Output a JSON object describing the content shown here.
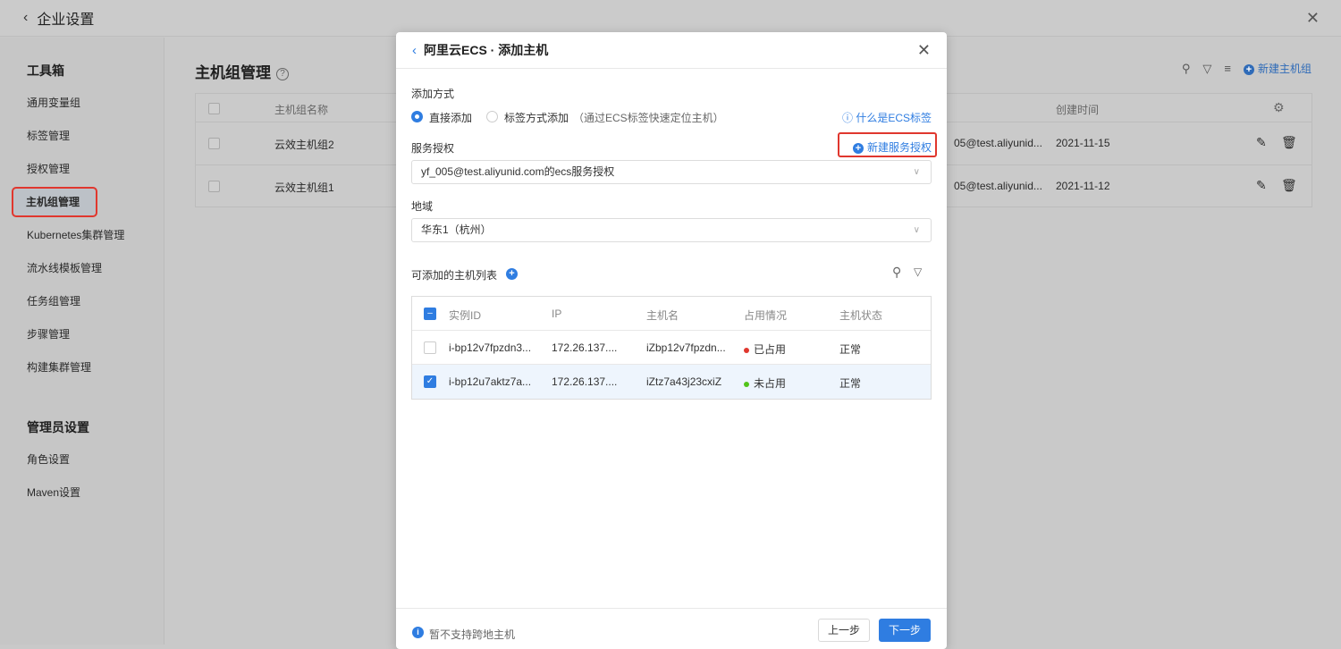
{
  "topbar": {
    "title": "企业设置"
  },
  "sidebar": {
    "section1": "工具箱",
    "items1": [
      "通用变量组",
      "标签管理",
      "授权管理",
      "主机组管理",
      "Kubernetes集群管理",
      "流水线模板管理",
      "任务组管理",
      "步骤管理",
      "构建集群管理"
    ],
    "section2": "管理员设置",
    "items2": [
      "角色设置",
      "Maven设置"
    ]
  },
  "main": {
    "title": "主机组管理",
    "new_button": "新建主机组",
    "columns": [
      "主机组名称",
      "创建时间"
    ],
    "rows": [
      {
        "name": "云效主机组2",
        "creator": "05@test.aliyunid...",
        "date": "2021-11-15"
      },
      {
        "name": "云效主机组1",
        "creator": "05@test.aliyunid...",
        "date": "2021-11-12"
      }
    ]
  },
  "modal": {
    "title": "阿里云ECS · 添加主机",
    "add_method_label": "添加方式",
    "radio_direct": "直接添加",
    "radio_tag": "标签方式添加",
    "radio_tag_hint": "（通过ECS标签快速定位主机）",
    "what_is_tag": "什么是ECS标签",
    "auth_label": "服务授权",
    "new_auth": "新建服务授权",
    "auth_value": "yf_005@test.aliyunid.com的ecs服务授权",
    "region_label": "地域",
    "region_value": "华东1（杭州）",
    "list_label": "可添加的主机列表",
    "columns": [
      "实例ID",
      "IP",
      "主机名",
      "占用情况",
      "主机状态"
    ],
    "hosts": [
      {
        "id": "i-bp12v7fpzdn3...",
        "ip": "172.26.137....",
        "name": "iZbp12v7fpzdn...",
        "usage": "已占用",
        "usage_color": "#e0372e",
        "status": "正常",
        "checked": false
      },
      {
        "id": "i-bp12u7aktz7a...",
        "ip": "172.26.137....",
        "name": "iZtz7a43j23cxiZ",
        "usage": "未占用",
        "usage_color": "#52c41a",
        "status": "正常",
        "checked": true
      }
    ],
    "footer_note": "暂不支持跨地主机",
    "prev": "上一步",
    "next": "下一步"
  }
}
